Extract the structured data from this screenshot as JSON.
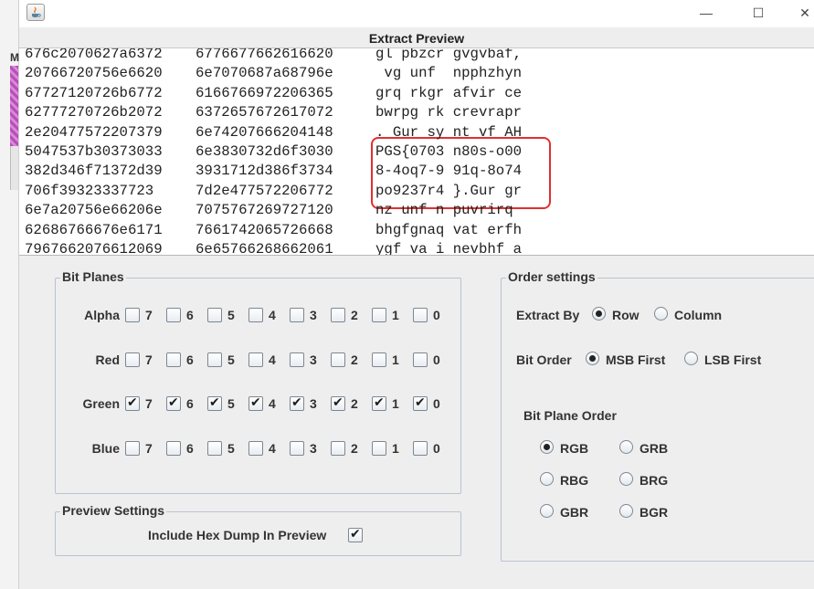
{
  "window": {
    "title": "Extract Preview",
    "min_glyph": "—",
    "max_glyph": "☐",
    "close_glyph": "✕"
  },
  "background_window": {
    "letter": "M"
  },
  "preview": {
    "lines": [
      {
        "hex1": "676c2070627a6372",
        "hex2": "6776677662616620",
        "text": "gl pbzcr gvgvbaf,"
      },
      {
        "hex1": "20766720756e6620",
        "hex2": "6e7070687a68796e",
        "text": " vg unf  npphzhyn"
      },
      {
        "hex1": "67727120726b6772",
        "hex2": "6166766972206365",
        "text": "grq rkgr afvir ce"
      },
      {
        "hex1": "62777270726b2072",
        "hex2": "6372657672617072",
        "text": "bwrpg rk crevrapr"
      },
      {
        "hex1": "2e20477572207379",
        "hex2": "6e74207666204148",
        "text": ". Gur sy nt vf AH"
      },
      {
        "hex1": "5047537b30373033",
        "hex2": "6e3830732d6f3030",
        "text": "PGS{0703 n80s-o00"
      },
      {
        "hex1": "382d346f71372d39",
        "hex2": "3931712d386f3734",
        "text": "8-4oq7-9 91q-8o74"
      },
      {
        "hex1": "706f39323337723",
        "hex2": "7d2e477572206772",
        "text": "po9237r4 }.Gur gr"
      },
      {
        "hex1": "6e7a20756e66206e",
        "hex2": "7075767269727120",
        "text": "nz unf n puvrirq "
      },
      {
        "hex1": "62686766676e6171",
        "hex2": "7661742065726668",
        "text": "bhgfgnaq vat erfh"
      },
      {
        "hex1": "7967662076612069",
        "hex2": "6e65766268662061",
        "text": "ygf va i nevbhf a"
      }
    ]
  },
  "bit_planes": {
    "title": "Bit Planes",
    "bits": [
      "7",
      "6",
      "5",
      "4",
      "3",
      "2",
      "1",
      "0"
    ],
    "channels": [
      {
        "name": "Alpha",
        "checked": [
          false,
          false,
          false,
          false,
          false,
          false,
          false,
          false
        ]
      },
      {
        "name": "Red",
        "checked": [
          false,
          false,
          false,
          false,
          false,
          false,
          false,
          false
        ]
      },
      {
        "name": "Green",
        "checked": [
          true,
          true,
          true,
          true,
          true,
          true,
          true,
          true
        ]
      },
      {
        "name": "Blue",
        "checked": [
          false,
          false,
          false,
          false,
          false,
          false,
          false,
          false
        ]
      }
    ]
  },
  "preview_settings": {
    "title": "Preview Settings",
    "include_hex_label": "Include Hex Dump In Preview",
    "include_hex_checked": true
  },
  "order_settings": {
    "title": "Order settings",
    "extract_by_label": "Extract By",
    "extract_by_options": [
      "Row",
      "Column"
    ],
    "extract_by_selected": "Row",
    "bit_order_label": "Bit Order",
    "bit_order_options": [
      "MSB First",
      "LSB First"
    ],
    "bit_order_selected": "MSB First",
    "plane_order_label": "Bit Plane Order",
    "plane_order_options": [
      "RGB",
      "GRB",
      "RBG",
      "BRG",
      "GBR",
      "BGR"
    ],
    "plane_order_selected": "RGB"
  }
}
